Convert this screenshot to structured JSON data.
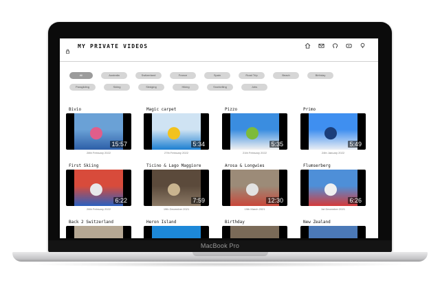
{
  "device": {
    "label": "MacBook Pro"
  },
  "header": {
    "title": "MY PRIVATE VIDEOS",
    "icons": [
      "home-icon",
      "mail-icon",
      "github-icon",
      "youtube-icon",
      "bulb-icon"
    ]
  },
  "filters": {
    "row1": [
      "All",
      "Australia",
      "Switzerland",
      "France",
      "Spain",
      "Road Trip",
      "Beach",
      "Birthday"
    ],
    "row2": [
      "Paragliding",
      "Skiing",
      "Sledging",
      "Hiking",
      "Snorkelling",
      "Jobs"
    ],
    "active": "All"
  },
  "videos": [
    {
      "title": "Bivio",
      "duration": "15:57",
      "date": "28th February 2022",
      "colors": [
        "#6aa1d6",
        "#2d5fa8",
        "#e05e8a"
      ]
    },
    {
      "title": "Magic carpet",
      "duration": "5:34",
      "date": "27th February 2022",
      "colors": [
        "#cfe3f3",
        "#1d7fd1",
        "#f2c21d"
      ]
    },
    {
      "title": "Pizzo",
      "duration": "5:35",
      "date": "21th February 2022",
      "colors": [
        "#3a8de0",
        "#f1f1f1",
        "#7dbb3b"
      ]
    },
    {
      "title": "Primo",
      "duration": "5:49",
      "date": "24th January 2022",
      "colors": [
        "#3f8ff0",
        "#e9eef4",
        "#1b3e7a"
      ]
    },
    {
      "title": "First Skiing",
      "duration": "6:22",
      "date": "26th February 2022",
      "colors": [
        "#d84b3b",
        "#2a5fbf",
        "#e7e7ea"
      ]
    },
    {
      "title": "Ticino & Lago Maggiore",
      "duration": "7:59",
      "date": "19th December 2021",
      "colors": [
        "#5b4a3b",
        "#8c7a66",
        "#c9b48f"
      ]
    },
    {
      "title": "Arosa & Longwies",
      "duration": "12:30",
      "date": "19th March 2021",
      "colors": [
        "#9c8b78",
        "#c9473a",
        "#e2e2e2"
      ]
    },
    {
      "title": "Flumserberg",
      "duration": "6:26",
      "date": "1st December 2021",
      "colors": [
        "#4e8fd8",
        "#d53a3a",
        "#f0f0f0"
      ]
    },
    {
      "title": "Back 2 Switzerland",
      "duration": "",
      "date": "",
      "colors": [
        "#b5a793",
        "#6b7e8f",
        "#e8d8c4"
      ]
    },
    {
      "title": "Heron Island",
      "duration": "",
      "date": "",
      "colors": [
        "#1d88d8",
        "#0d62b0",
        "#57b5ef"
      ]
    },
    {
      "title": "Birthday",
      "duration": "",
      "date": "",
      "colors": [
        "#7a6a58",
        "#c7b8a3",
        "#3a6fc0"
      ]
    },
    {
      "title": "New Zealand",
      "duration": "",
      "date": "",
      "colors": [
        "#4b79b7",
        "#9cc3e6",
        "#e2ecf6"
      ]
    }
  ]
}
